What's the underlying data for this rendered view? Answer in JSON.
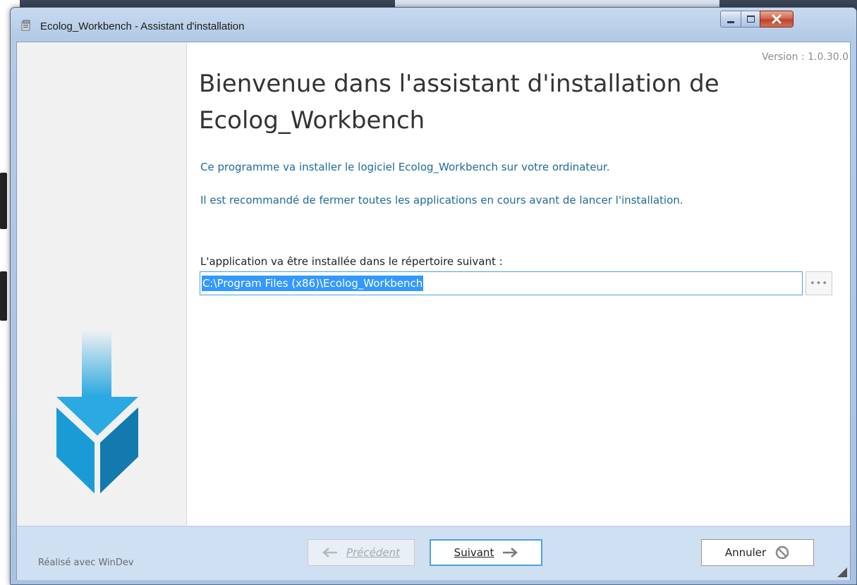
{
  "window": {
    "title": "Ecolog_Workbench - Assistant d'installation"
  },
  "content": {
    "version": "Version : 1.0.30.0",
    "heading": "Bienvenue dans l'assistant d'installation de Ecolog_Workbench",
    "description_1": "Ce programme va installer le logiciel Ecolog_Workbench sur votre ordinateur.",
    "description_2": "Il est recommandé de fermer toutes les applications en cours avant de lancer l'installation.",
    "directory_label": "L'application va être installée dans le répertoire suivant :",
    "directory_value": "C:\\Program Files (x86)\\Ecolog_Workbench",
    "browse_label": "•••"
  },
  "footer": {
    "credit": "Réalisé avec WinDev",
    "previous_label": "Précédent",
    "next_label": "Suivant",
    "cancel_label": "Annuler"
  },
  "colors": {
    "accent": "#1e6a9a",
    "selection": "#3399ff",
    "footer_bg": "#cfe0f2"
  },
  "icons": {
    "app": "installer-icon",
    "sidebar": "download-box-icon",
    "previous": "arrow-left-icon",
    "next": "arrow-right-icon",
    "cancel": "cancel-circle-icon"
  }
}
